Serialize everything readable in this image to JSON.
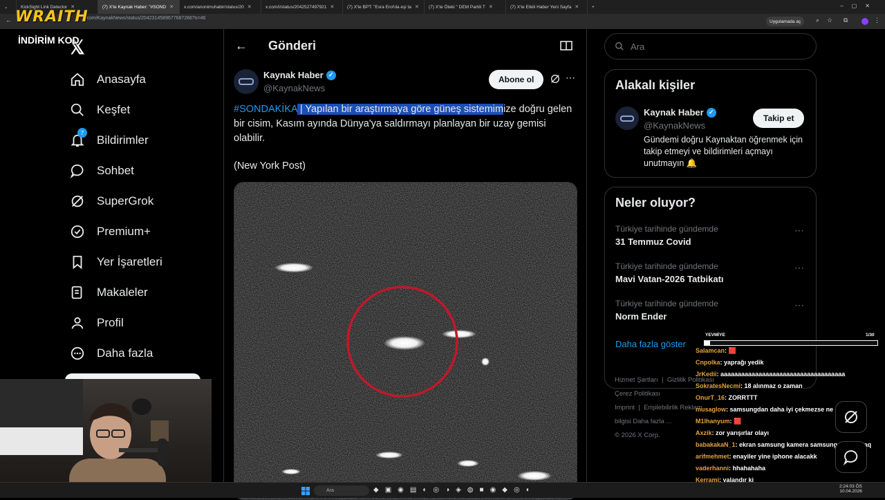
{
  "browser": {
    "tabs": [
      {
        "title": "KickSight Link Detector"
      },
      {
        "title": "(7) X'te Kaynak Haber: \"#SOND",
        "active": true
      },
      {
        "title": "x.com/anonimuhabir/status/20"
      },
      {
        "title": "x.com/i/status/2042527497921"
      },
      {
        "title": "(7) X'te BPT: \"Esra Erol'da eşi ta"
      },
      {
        "title": "(7) X'te Öteki \" DEM Partili T"
      },
      {
        "title": "(7) X'te Etkili Haber Yeni Sayfa"
      }
    ],
    "url": "x.com/KaynakNews/status/2042314589677687266?s=46",
    "app_button": "Uygulamada aç"
  },
  "nav": {
    "items": [
      {
        "label": "Anasayfa",
        "icon": "home-icon"
      },
      {
        "label": "Keşfet",
        "icon": "search-icon"
      },
      {
        "label": "Bildirimler",
        "icon": "bell-icon",
        "badge": "7"
      },
      {
        "label": "Sohbet",
        "icon": "chat-icon"
      },
      {
        "label": "SuperGrok",
        "icon": "grok-icon"
      },
      {
        "label": "Premium+",
        "icon": "verified-icon"
      },
      {
        "label": "Yer İşaretleri",
        "icon": "bookmark-icon"
      },
      {
        "label": "Makaleler",
        "icon": "article-icon"
      },
      {
        "label": "Profil",
        "icon": "profile-icon"
      },
      {
        "label": "Daha fazla",
        "icon": "more-icon"
      }
    ]
  },
  "post": {
    "header_title": "Gönderi",
    "author_name": "Kaynak Haber",
    "author_handle": "@KaynakNews",
    "subscribe_label": "Abone ol",
    "hashtag": "#SONDAKİKA",
    "text_selected": " | Yapılan bir araştırmaya göre güneş sistemim",
    "text_rest": "ize doğru gelen bir cisim, Kasım ayında Dünya'ya saldırmayı planlayan bir uzay gemisi olabilir.",
    "source": "(New York Post)"
  },
  "search": {
    "placeholder": "Ara"
  },
  "related": {
    "title": "Alakalı kişiler",
    "name": "Kaynak Haber",
    "handle": "@KaynakNews",
    "bio": "Gündemi doğru Kaynaktan öğrenmek için takip etmeyi ve bildirimleri açmayı unutmayın 🔔",
    "follow_label": "Takip et"
  },
  "trends": {
    "title": "Neler oluyor?",
    "items": [
      {
        "meta": "Türkiye tarihinde gündemde",
        "name": "31 Temmuz Covid"
      },
      {
        "meta": "Türkiye tarihinde gündemde",
        "name": "Mavi Vatan-2026 Tatbikatı"
      },
      {
        "meta": "Türkiye tarihinde gündemde",
        "name": "Norm Ender"
      }
    ],
    "show_more": "Daha fazla göster"
  },
  "footer": {
    "links": [
      "Hizmet Şartları",
      "Gizlilik Politikası",
      "Çerez Politikası",
      "Imprint",
      "Erişilebilirlik",
      "Reklam bilgisi",
      "Daha fazla ..."
    ],
    "copyright": "© 2026 X Corp."
  },
  "overlay": {
    "brand": "WRAITH",
    "promo": "İNDİRİM KOD",
    "progress_label": "YEVMİYE",
    "progress_count": "1/30",
    "progress_fraction": 0.033
  },
  "chat": [
    {
      "user": "Salamcan",
      "msg": ": 🟥"
    },
    {
      "user": "Cnpolka",
      "msg": ": yaprağı yedik"
    },
    {
      "user": "JrKedii",
      "msg": ": aaaaaaaaaaaaaaaaaaaaaaaaaaaaaaaaaaaa"
    },
    {
      "user": "SokratesNecmi",
      "msg": ": 18 alınmaz o zaman"
    },
    {
      "user": "OnurT_16",
      "msg": ": ZORRTTT"
    },
    {
      "user": "musaglow",
      "msg": ": samsungdan daha iyi çekmezse ne olayım aq"
    },
    {
      "user": "M1lhanyum",
      "msg": ": 🟥"
    },
    {
      "user": "Axzik",
      "msg": ": zor yarışırlar olayı"
    },
    {
      "user": "babakakaN_1",
      "msg": ": ekran samsung kamera samsung ne kaldı aq"
    },
    {
      "user": "arifmehmet",
      "msg": ": enayiler yine iphone alacakk"
    },
    {
      "user": "vaderhanni",
      "msg": ": hhahahaha"
    },
    {
      "user": "Kerrami",
      "msg": ": yalandır ki"
    },
    {
      "user": "Karinagill",
      "msg": ": yapmaaaaaa"
    }
  ],
  "taskbar": {
    "search_placeholder": "Ara",
    "time": "2:24:03 ÖS",
    "date": "10.04.2026"
  },
  "colors": {
    "accent": "#1d9bf0",
    "background": "#000000",
    "border": "#2f3336",
    "selection": "#1a4fb5",
    "circle": "#c0182b"
  }
}
